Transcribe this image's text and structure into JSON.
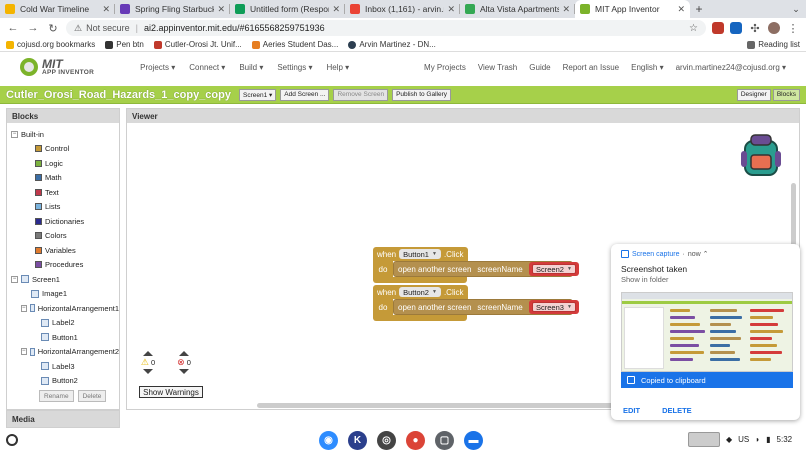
{
  "browser": {
    "tabs": [
      {
        "label": "Cold War Timeline",
        "color": "#f4b400"
      },
      {
        "label": "Spring Fling Starbucks - Go",
        "color": "#673ab7"
      },
      {
        "label": "Untitled form (Responses)",
        "color": "#0f9d58"
      },
      {
        "label": "Inbox (1,161) - arvin.martin",
        "color": "#ea4335"
      },
      {
        "label": "Alta Vista Apartments - Go",
        "color": "#34a853"
      },
      {
        "label": "MIT App Inventor",
        "color": "#7cb32a",
        "active": true
      }
    ],
    "address": {
      "not_secure": "Not secure",
      "url": "ai2.appinventor.mit.edu/#6165568259751936"
    },
    "bookmarks": [
      "cojusd.org bookmarks",
      "Pen btn",
      "Cutler-Orosi Jt. Unif...",
      "Aeries Student Das...",
      "Arvin Martinez - DN..."
    ],
    "reading_list": "Reading list"
  },
  "ai_header": {
    "logo_mit": "MIT",
    "logo_sub": "APP INVENTOR",
    "menu": [
      "Projects ▾",
      "Connect ▾",
      "Build ▾",
      "Settings ▾",
      "Help ▾"
    ],
    "right": [
      "My Projects",
      "View Trash",
      "Guide",
      "Report an Issue",
      "English ▾",
      "arvin.martinez24@cojusd.org ▾"
    ]
  },
  "project_bar": {
    "name": "Cutler_Orosi_Road_Hazards_1_copy_copy",
    "screen_btn": "Screen1 ▾",
    "add_screen": "Add Screen ...",
    "remove_screen": "Remove Screen",
    "publish": "Publish to Gallery",
    "designer": "Designer",
    "blocks": "Blocks"
  },
  "blocks_panel": {
    "title": "Blocks",
    "builtin": "Built-in",
    "categories": [
      {
        "label": "Control",
        "color": "#c59a38"
      },
      {
        "label": "Logic",
        "color": "#7cb33f"
      },
      {
        "label": "Math",
        "color": "#3b6ea5"
      },
      {
        "label": "Text",
        "color": "#c0394b"
      },
      {
        "label": "Lists",
        "color": "#7ab3dd"
      },
      {
        "label": "Dictionaries",
        "color": "#2b2b8f"
      },
      {
        "label": "Colors",
        "color": "#7a7a7a"
      },
      {
        "label": "Variables",
        "color": "#e07b2e"
      },
      {
        "label": "Procedures",
        "color": "#7b4ea3"
      }
    ],
    "components": [
      {
        "label": "Screen1",
        "level": 0,
        "toggle": "−"
      },
      {
        "label": "Image1",
        "level": 1
      },
      {
        "label": "HorizontalArrangement1",
        "level": 1,
        "toggle": "−"
      },
      {
        "label": "Label2",
        "level": 2
      },
      {
        "label": "Button1",
        "level": 2
      },
      {
        "label": "HorizontalArrangement2",
        "level": 1,
        "toggle": "−"
      },
      {
        "label": "Label3",
        "level": 2
      },
      {
        "label": "Button2",
        "level": 2
      }
    ],
    "rename": "Rename",
    "delete": "Delete",
    "media": "Media"
  },
  "viewer": {
    "title": "Viewer",
    "events": [
      {
        "when": "when",
        "component": "Button1",
        "event": ".Click",
        "do": "do",
        "call": "open another screen",
        "param": "screenName",
        "value": "Screen2"
      },
      {
        "when": "when",
        "component": "Button2",
        "event": ".Click",
        "do": "do",
        "call": "open another screen",
        "param": "screenName",
        "value": "Screen3"
      }
    ],
    "warnings_count": "0",
    "errors_count": "0",
    "show_warnings": "Show Warnings"
  },
  "notification": {
    "app": "Screen capture",
    "time": "now ⌃",
    "title": "Screenshot taken",
    "subtitle": "Show in folder",
    "copied": "Copied to clipboard",
    "edit": "EDIT",
    "delete": "DELETE"
  },
  "shelf": {
    "apps": [
      {
        "name": "zoom",
        "color": "#2d8cff",
        "glyph": "◉"
      },
      {
        "name": "kami",
        "color": "#2b3f8c",
        "glyph": "K"
      },
      {
        "name": "camera",
        "color": "#444444",
        "glyph": "◎"
      },
      {
        "name": "chrome",
        "color": "#db4437",
        "glyph": "●"
      },
      {
        "name": "screen",
        "color": "#5f6368",
        "glyph": "▢"
      },
      {
        "name": "files",
        "color": "#1a73e8",
        "glyph": "▬"
      }
    ],
    "region": "US",
    "time": "5:32"
  }
}
